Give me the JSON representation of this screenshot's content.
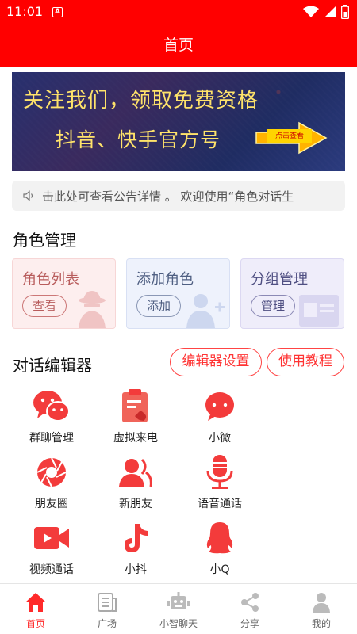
{
  "status_bar": {
    "time": "11:01",
    "notification_letter": "A"
  },
  "app_bar": {
    "title": "首页"
  },
  "banner": {
    "line1": "关注我们，领取免费资格",
    "line2": "抖音、快手官方号",
    "cta": "点击查看"
  },
  "notice": {
    "text": "击此处可查看公告详情 。 欢迎使用“角色对话生"
  },
  "role_section": {
    "title": "角色管理",
    "cards": [
      {
        "title": "角色列表",
        "button": "查看",
        "accent": "#b85c5c",
        "bg": "#fdeeee"
      },
      {
        "title": "添加角色",
        "button": "添加",
        "accent": "#4f5f82",
        "bg": "#eef2fc"
      },
      {
        "title": "分组管理",
        "button": "管理",
        "accent": "#4f4f82",
        "bg": "#efedfa"
      }
    ]
  },
  "editor_section": {
    "title": "对话编辑器",
    "settings_button": "编辑器设置",
    "tutorial_button": "使用教程"
  },
  "features": [
    {
      "label": "群聊管理",
      "icon": "wechat-icon"
    },
    {
      "label": "虚拟来电",
      "icon": "clipboard-phone-icon"
    },
    {
      "label": "小微",
      "icon": "chat-bubble-icon"
    },
    {
      "label": "朋友圈",
      "icon": "aperture-icon"
    },
    {
      "label": "新朋友",
      "icon": "new-friend-icon"
    },
    {
      "label": "语音通话",
      "icon": "microphone-icon"
    },
    {
      "label": "视频通话",
      "icon": "video-camera-icon"
    },
    {
      "label": "小抖",
      "icon": "tiktok-icon"
    },
    {
      "label": "小Q",
      "icon": "qq-penguin-icon"
    }
  ],
  "tab_bar": {
    "tabs": [
      {
        "label": "首页",
        "icon": "home-icon",
        "active": true
      },
      {
        "label": "广场",
        "icon": "newspaper-icon",
        "active": false
      },
      {
        "label": "小智聊天",
        "icon": "robot-icon",
        "active": false
      },
      {
        "label": "分享",
        "icon": "share-icon",
        "active": false
      },
      {
        "label": "我的",
        "icon": "person-icon",
        "active": false
      }
    ]
  },
  "colors": {
    "primary": "#ff0000",
    "icon_red": "#f33b3b",
    "tab_inactive": "#bbbbbb"
  }
}
